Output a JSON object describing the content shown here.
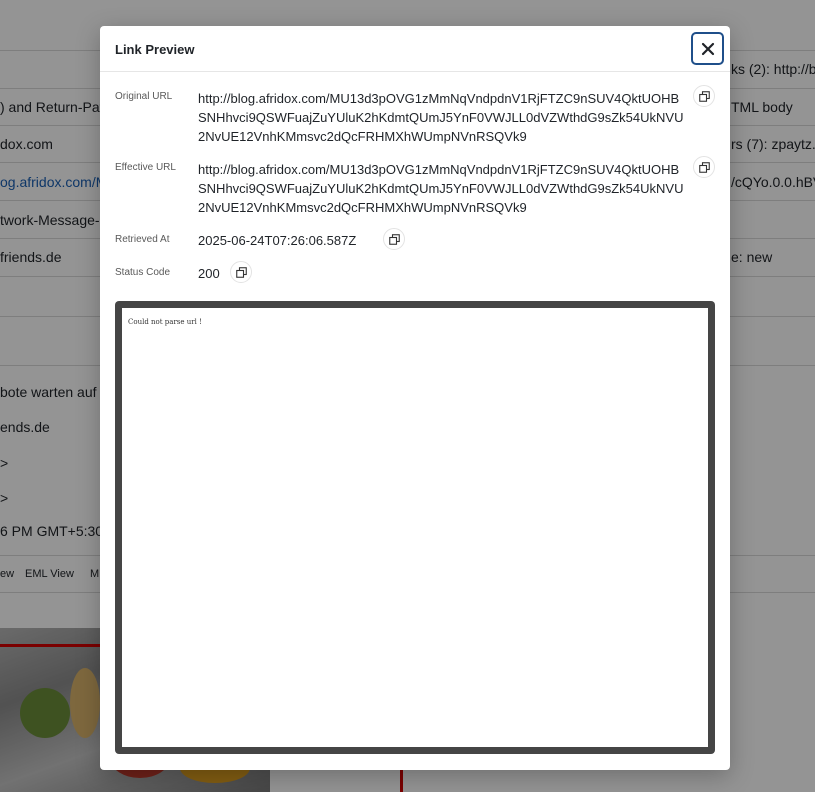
{
  "background": {
    "lines": [
      "ks (2): http://b",
      ") and Return-Pat",
      "TML body",
      "dox.com",
      "rs (7): zpaytz.",
      "og.afridox.com/M",
      "/cQYo.0.0.hBV",
      "twork-Message-",
      "friends.de",
      "e: new",
      "bote warten auf",
      "ends.de",
      ">",
      ">",
      "6 PM GMT+5:30"
    ],
    "tabs": [
      "ew",
      "EML View",
      "M"
    ]
  },
  "modal": {
    "title": "Link Preview",
    "close_label": "Close",
    "fields": {
      "original_url": {
        "label": "Original URL",
        "value": "http://blog.afridox.com/MU13d3pOVG1zMmNqVndpdnV1RjFTZC9nSUV4QktUOHBSNHhvci9QSWFuajZuYUluK2hKdmtQUmJ5YnF0VWJLL0dVZWthdG9sZk54UkNVU2NvUE12VnhKMmsvc2dQcFRHMXhWUmpNVnRSQVk9"
      },
      "effective_url": {
        "label": "Effective URL",
        "value": "http://blog.afridox.com/MU13d3pOVG1zMmNqVndpdnV1RjFTZC9nSUV4QktUOHBSNHhvci9QSWFuajZuYUluK2hKdmtQUmJ5YnF0VWJLL0dVZWthdG9sZk54UkNVU2NvUE12VnhKMmsvc2dQcFRHMXhWUmpNVnRSQVk9"
      },
      "retrieved_at": {
        "label": "Retrieved At",
        "value": "2025-06-24T07:26:06.587Z"
      },
      "status_code": {
        "label": "Status Code",
        "value": "200"
      }
    },
    "preview_text": "Could not parse url !"
  },
  "colors": {
    "accent": "#1f4f8a",
    "link": "#1a5fb4",
    "frame": "#454545",
    "overlay": "rgba(0,0,0,0.42)"
  },
  "icons": {
    "close": "close-icon",
    "copy": "copy-icon"
  }
}
